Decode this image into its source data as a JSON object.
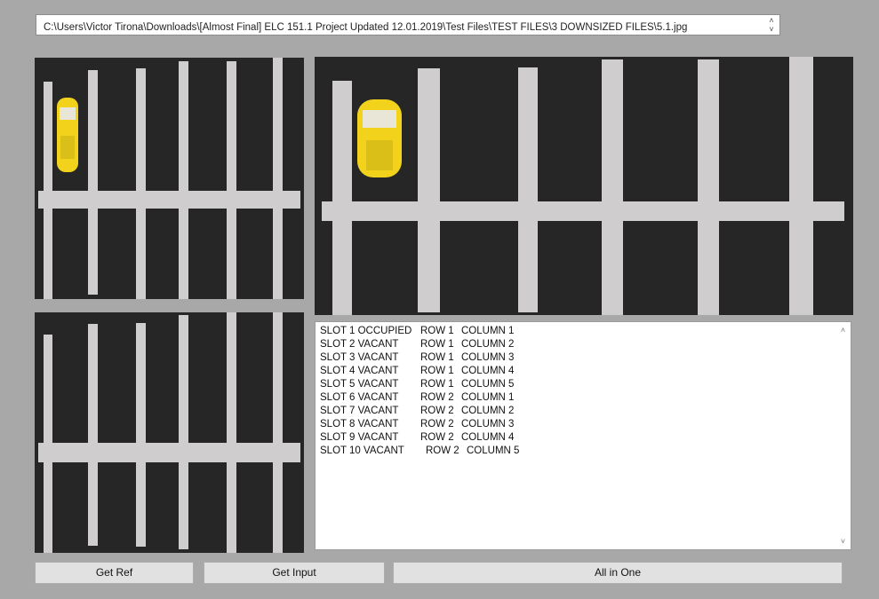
{
  "file_path": {
    "value": "C:\\Users\\Victor Tirona\\Downloads\\[Almost Final] ELC 151.1 Project Updated 12.01.2019\\Test Files\\TEST FILES\\3 DOWNSIZED FILES\\5.1.jpg",
    "spin_up": "˄",
    "spin_down": "˅"
  },
  "results": {
    "rows": [
      {
        "slot": "SLOT 1 OCCUPIED",
        "row": "ROW 1",
        "column": "COLUMN 1"
      },
      {
        "slot": "SLOT 2 VACANT",
        "row": "ROW 1",
        "column": "COLUMN 2"
      },
      {
        "slot": "SLOT 3 VACANT",
        "row": "ROW 1",
        "column": "COLUMN 3"
      },
      {
        "slot": "SLOT 4 VACANT",
        "row": "ROW 1",
        "column": "COLUMN 4"
      },
      {
        "slot": "SLOT 5 VACANT",
        "row": "ROW 1",
        "column": "COLUMN 5"
      },
      {
        "slot": "SLOT 6 VACANT",
        "row": "ROW 2",
        "column": "COLUMN 1"
      },
      {
        "slot": "SLOT 7 VACANT",
        "row": "ROW 2",
        "column": "COLUMN 2"
      },
      {
        "slot": "SLOT 8 VACANT",
        "row": "ROW 2",
        "column": "COLUMN 3"
      },
      {
        "slot": "SLOT 9 VACANT",
        "row": "ROW 2",
        "column": "COLUMN 4"
      },
      {
        "slot": "SLOT 10 VACANT",
        "row": "ROW 2",
        "column": "COLUMN 5"
      }
    ],
    "scroll_up": "˄",
    "scroll_down": "˅"
  },
  "buttons": {
    "get_ref": "Get Ref",
    "get_input": "Get Input",
    "all_in_one": "All in One"
  },
  "colors": {
    "background": "#a8a8a8",
    "board": "#262626",
    "tape": "#d9d6d8",
    "car": "#f2d21b"
  }
}
